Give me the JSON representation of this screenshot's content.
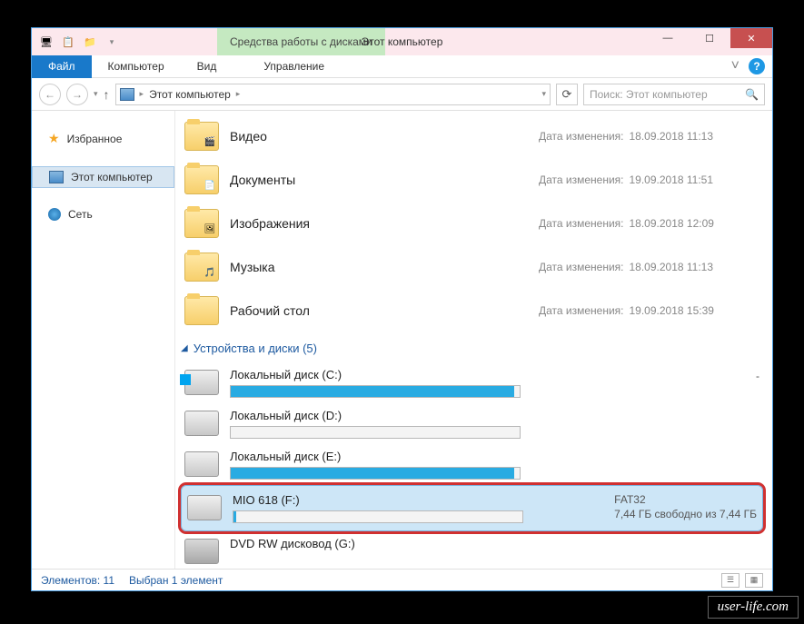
{
  "titlebar": {
    "context_tab": "Средства работы с дисками",
    "title": "Этот компьютер"
  },
  "ribbon": {
    "file": "Файл",
    "tabs": [
      "Компьютер",
      "Вид"
    ],
    "manage": "Управление",
    "expand": "˅"
  },
  "address": {
    "location": "Этот компьютер",
    "search_placeholder": "Поиск: Этот компьютер"
  },
  "sidebar": {
    "favorites": "Избранное",
    "this_pc": "Этот компьютер",
    "network": "Сеть"
  },
  "folders_meta_label": "Дата изменения:",
  "folders": [
    {
      "name": "Видео",
      "date": "18.09.2018 11:13",
      "overlay": "🎬"
    },
    {
      "name": "Документы",
      "date": "19.09.2018 11:51",
      "overlay": "📄"
    },
    {
      "name": "Изображения",
      "date": "18.09.2018 12:09",
      "overlay": "🖼"
    },
    {
      "name": "Музыка",
      "date": "18.09.2018 11:13",
      "overlay": "🎵"
    },
    {
      "name": "Рабочий стол",
      "date": "19.09.2018 15:39",
      "overlay": ""
    }
  ],
  "group_header": "Устройства и диски (5)",
  "drives": [
    {
      "name": "Локальный диск (C:)",
      "fill_pct": 98,
      "icon": "win",
      "side1": "",
      "side2": "-"
    },
    {
      "name": "Локальный диск (D:)",
      "fill_pct": 0,
      "icon": "hdd",
      "side1": "",
      "side2": ""
    },
    {
      "name": "Локальный диск (E:)",
      "fill_pct": 98,
      "icon": "hdd",
      "side1": "",
      "side2": ""
    },
    {
      "name": "MIO 618 (F:)",
      "fill_pct": 1,
      "icon": "hdd",
      "side1": "FAT32",
      "side2": "7,44 ГБ свободно из 7,44 ГБ",
      "selected": true,
      "highlighted": true
    },
    {
      "name": "DVD RW дисковод (G:)",
      "fill_pct": null,
      "icon": "dvd",
      "side1": "",
      "side2": ""
    }
  ],
  "statusbar": {
    "items": "Элементов: 11",
    "selected": "Выбран 1 элемент"
  },
  "watermark": "user-life.com"
}
